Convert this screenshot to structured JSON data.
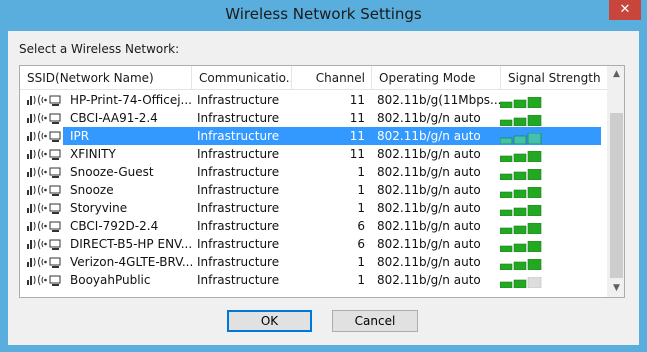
{
  "window": {
    "title": "Wireless Network Settings",
    "close_glyph": "✕"
  },
  "prompt": "Select a Wireless Network:",
  "columns": [
    "SSID(Network Name)",
    "Communicatio...",
    "Channel",
    "Operating Mode",
    "Signal Strength"
  ],
  "networks": [
    {
      "ssid": "HP-Print-74-Officej...",
      "comm": "Infrastructure",
      "channel": "11",
      "mode": "802.11b/g(11Mbps...",
      "signal": 3,
      "selected": false
    },
    {
      "ssid": "CBCI-AA91-2.4",
      "comm": "Infrastructure",
      "channel": "11",
      "mode": "802.11b/g/n auto",
      "signal": 3,
      "selected": false
    },
    {
      "ssid": "IPR",
      "comm": "Infrastructure",
      "channel": "11",
      "mode": "802.11b/g/n auto",
      "signal": 3,
      "selected": true
    },
    {
      "ssid": "XFINITY",
      "comm": "Infrastructure",
      "channel": "11",
      "mode": "802.11b/g/n auto",
      "signal": 3,
      "selected": false
    },
    {
      "ssid": "Snooze-Guest",
      "comm": "Infrastructure",
      "channel": "1",
      "mode": "802.11b/g/n auto",
      "signal": 3,
      "selected": false
    },
    {
      "ssid": "Snooze",
      "comm": "Infrastructure",
      "channel": "1",
      "mode": "802.11b/g/n auto",
      "signal": 3,
      "selected": false
    },
    {
      "ssid": "Storyvine",
      "comm": "Infrastructure",
      "channel": "1",
      "mode": "802.11b/g/n auto",
      "signal": 3,
      "selected": false
    },
    {
      "ssid": "CBCI-792D-2.4",
      "comm": "Infrastructure",
      "channel": "6",
      "mode": "802.11b/g/n auto",
      "signal": 3,
      "selected": false
    },
    {
      "ssid": "DIRECT-B5-HP ENV...",
      "comm": "Infrastructure",
      "channel": "6",
      "mode": "802.11b/g/n auto",
      "signal": 3,
      "selected": false
    },
    {
      "ssid": "Verizon-4GLTE-BRV...",
      "comm": "Infrastructure",
      "channel": "1",
      "mode": "802.11b/g/n auto",
      "signal": 3,
      "selected": false
    },
    {
      "ssid": "BooyahPublic",
      "comm": "Infrastructure",
      "channel": "1",
      "mode": "802.11b/g/n auto",
      "signal": 2,
      "selected": false
    }
  ],
  "row_icons": [
    "signal-icon",
    "wireless-icon",
    "computer-icon"
  ],
  "buttons": {
    "ok": "OK",
    "cancel": "Cancel"
  },
  "scroll_arrows": {
    "up": "▲",
    "down": "▼"
  },
  "colors": {
    "titlebar": "#5aaede",
    "selection": "#3399ff",
    "signal_on": "#22a822",
    "signal_off": "#dddddd",
    "close": "#c7453a"
  }
}
